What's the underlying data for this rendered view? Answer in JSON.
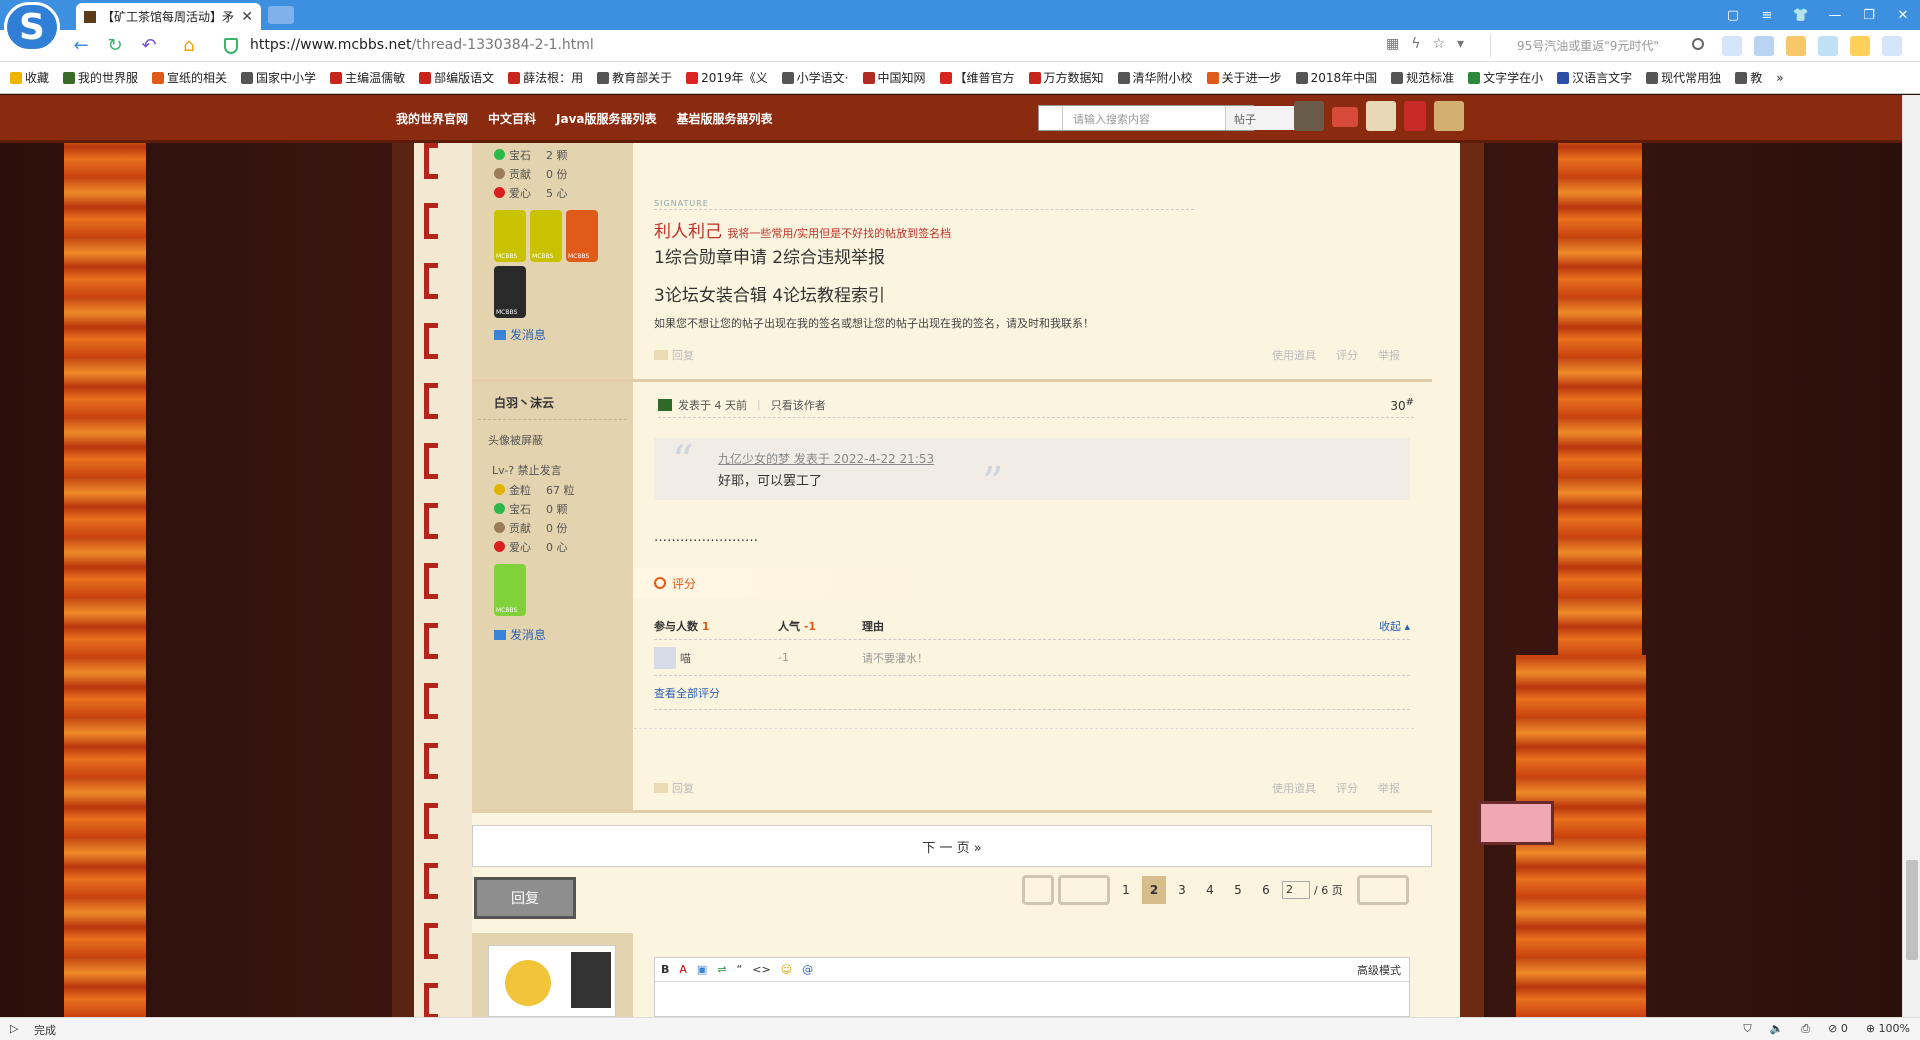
{
  "browser": {
    "tab_title": "【矿工茶馆每周活动】矛",
    "url_host": "https://www.mcbbs.net",
    "url_path": "/thread-1330384-2-1.html",
    "search_placeholder": "95号汽油或重返\"9元时代\"",
    "status_text": "完成",
    "zoom": "100%",
    "counter": "0"
  },
  "bookmarks": [
    {
      "label": "收藏",
      "color": "#f0b400"
    },
    {
      "label": "我的世界服",
      "color": "#3a6b2a"
    },
    {
      "label": "宣纸的相关",
      "color": "#e05a1a"
    },
    {
      "label": "国家中小学",
      "color": "#555555"
    },
    {
      "label": "主编温儒敏",
      "color": "#c8261c"
    },
    {
      "label": "部编版语文",
      "color": "#c8261c"
    },
    {
      "label": "薛法根：用",
      "color": "#c8261c"
    },
    {
      "label": "教育部关于",
      "color": "#555555"
    },
    {
      "label": "2019年《义",
      "color": "#d8251f"
    },
    {
      "label": "小学语文·",
      "color": "#555555"
    },
    {
      "label": "中国知网",
      "color": "#b22a22"
    },
    {
      "label": "【维普官方",
      "color": "#d8251f"
    },
    {
      "label": "万方数据知",
      "color": "#c8261c"
    },
    {
      "label": "清华附小校",
      "color": "#555555"
    },
    {
      "label": "关于进一步",
      "color": "#e05a1a"
    },
    {
      "label": "2018年中国",
      "color": "#555555"
    },
    {
      "label": "规范标准",
      "color": "#555555"
    },
    {
      "label": "文字学在小",
      "color": "#2a8a3a"
    },
    {
      "label": "汉语言文字",
      "color": "#2b4fa8"
    },
    {
      "label": "现代常用独",
      "color": "#555555"
    },
    {
      "label": "教",
      "color": "#555555"
    }
  ],
  "site_nav": {
    "links": [
      "我的世界官网",
      "中文百科",
      "Java版服务器列表",
      "基岩版服务器列表"
    ],
    "search_placeholder": "请输入搜索内容",
    "search_scope": "帖子"
  },
  "post_prev": {
    "stats": [
      {
        "label": "宝石",
        "value": "2 颗",
        "color": "#2db84a"
      },
      {
        "label": "贡献",
        "value": "0 份",
        "color": "#9a7b5a"
      },
      {
        "label": "爱心",
        "value": "5 心",
        "color": "#d82020"
      }
    ],
    "send_msg": "发消息",
    "sig_label": "SIGNATURE",
    "sig_title": "利人利己",
    "sig_note": "我将一些常用/实用但是不好找的帖放到签名档",
    "sig_line1": "1综合勋章申请  2综合违规举报",
    "sig_line2": "3论坛女装合辑  4论坛教程索引",
    "sig_notice": "如果您不想让您的帖子出现在我的签名或想让您的帖子出现在我的签名，请及时和我联系！",
    "reply": "回复",
    "tools": [
      "使用道具",
      "评分",
      "举报"
    ]
  },
  "post": {
    "author": "白羽丶沫云",
    "avatar_hidden": "头像被屏蔽",
    "level": "Lv-? 禁止发言",
    "stats": [
      {
        "label": "金粒",
        "value": "67 粒",
        "color": "#e0b400"
      },
      {
        "label": "宝石",
        "value": "0 颗",
        "color": "#2db84a"
      },
      {
        "label": "贡献",
        "value": "0 份",
        "color": "#9a7b5a"
      },
      {
        "label": "爱心",
        "value": "0 心",
        "color": "#d82020"
      }
    ],
    "send_msg": "发消息",
    "posted": "发表于 4 天前",
    "only_author": "只看该作者",
    "floor": "30",
    "floor_sup": "#",
    "quote_meta": "九亿少女的梦  发表于 2022-4-22 21:53",
    "quote_text": "好耶，可以罢工了",
    "body": "……………………",
    "rate_label": "评分",
    "rate_headers": {
      "participants": "参与人数",
      "participants_count": "1",
      "popularity": "人气",
      "popularity_value": "-1",
      "reason": "理由",
      "collapse": "收起"
    },
    "rate_row": {
      "user": "喵",
      "score": "-1",
      "reason": "请不要灌水！"
    },
    "view_all": "查看全部评分",
    "reply": "回复",
    "tools": [
      "使用道具",
      "评分",
      "举报"
    ]
  },
  "pager": {
    "next": "下 一 页  »",
    "reply_btn": "回复",
    "pages": [
      "1",
      "2",
      "3",
      "4",
      "5",
      "6"
    ],
    "current": "2",
    "input": "2",
    "total": "/ 6 页"
  },
  "editor": {
    "tools": [
      "B",
      "A",
      "▣",
      "⇌",
      "“",
      "<>",
      "☺",
      "@"
    ],
    "advanced": "高级模式"
  }
}
